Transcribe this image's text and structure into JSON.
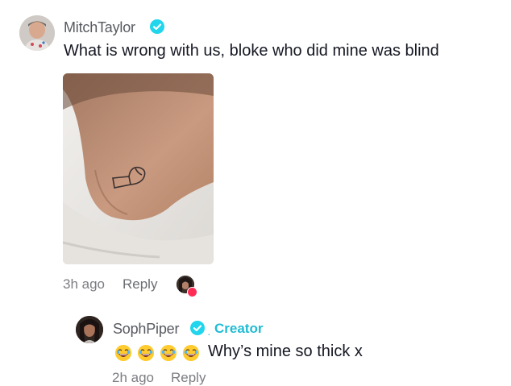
{
  "comment": {
    "username": "MitchTaylor",
    "text": "What is wrong with us, bloke who did mine was blind",
    "time": "3h ago",
    "reply_label": "Reply",
    "photo_icon": "foot-tattoo-photo"
  },
  "reply": {
    "username": "SophPiper",
    "badge": "Creator",
    "emoji_icon": "laughing-emoji",
    "text": "Why’s mine so thick x",
    "time": "2h ago",
    "reply_label": "Reply"
  },
  "colors": {
    "verified": "#20d5ec",
    "creator": "#20bcd4",
    "heart": "#fe2c55",
    "meta": "#7b7d82"
  }
}
